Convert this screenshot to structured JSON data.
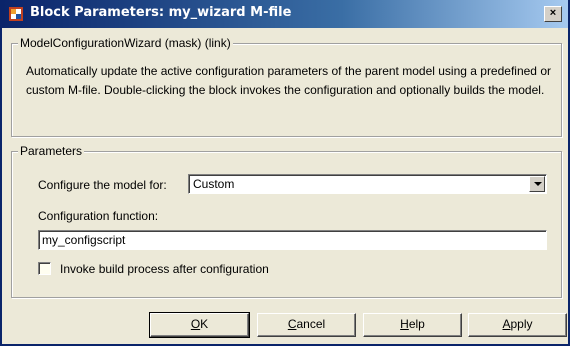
{
  "window": {
    "title": "Block Parameters: my_wizard M-file",
    "close_label": "×",
    "icon": "simulink-block-icon"
  },
  "mask_group": {
    "legend": "ModelConfigurationWizard (mask) (link)",
    "description": "Automatically update the active configuration parameters of the parent model using a predefined or custom M-file.  Double-clicking the block invokes the configuration and optionally builds the model."
  },
  "parameters_group": {
    "legend": "Parameters",
    "configure_label": "Configure the model for:",
    "configure_value": "Custom",
    "function_label": "Configuration function:",
    "function_value": "my_configscript",
    "build_checkbox_label": "Invoke build process after configuration",
    "build_checked": false
  },
  "buttons": {
    "ok": {
      "mnemonic": "O",
      "rest": "K"
    },
    "cancel": {
      "mnemonic": "C",
      "rest": "ancel"
    },
    "help": {
      "mnemonic": "H",
      "rest": "elp"
    },
    "apply": {
      "mnemonic": "A",
      "rest": "pply"
    }
  }
}
